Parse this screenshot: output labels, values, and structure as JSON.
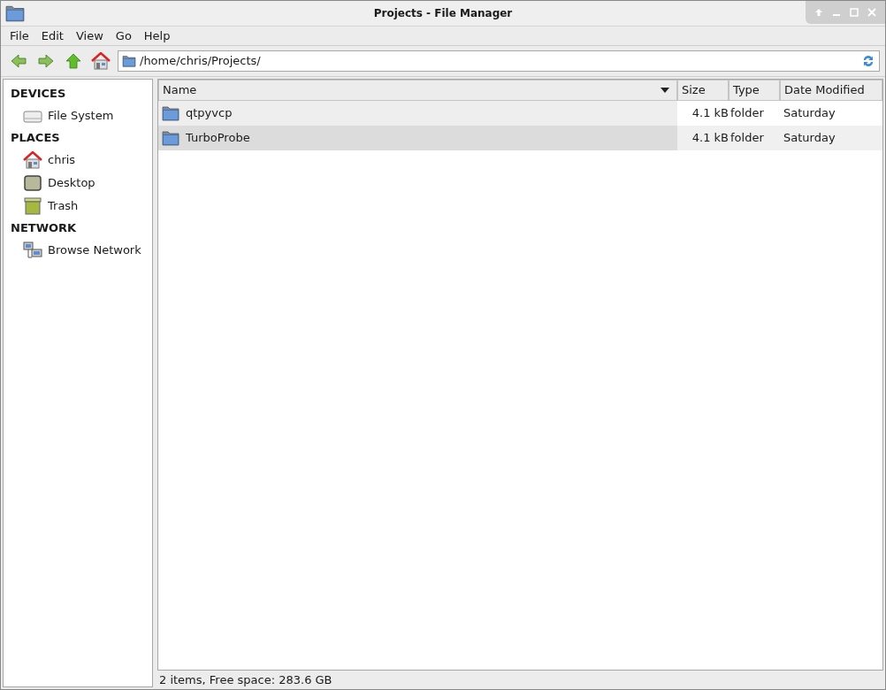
{
  "window": {
    "title": "Projects - File Manager"
  },
  "menu": [
    "File",
    "Edit",
    "View",
    "Go",
    "Help"
  ],
  "toolbar": {
    "path": "/home/chris/Projects/"
  },
  "sidebar": [
    {
      "heading": "DEVICES",
      "items": [
        {
          "label": "File System",
          "kind": "drive"
        }
      ]
    },
    {
      "heading": "PLACES",
      "items": [
        {
          "label": "chris",
          "kind": "home"
        },
        {
          "label": "Desktop",
          "kind": "desktop"
        },
        {
          "label": "Trash",
          "kind": "trash"
        }
      ]
    },
    {
      "heading": "NETWORK",
      "items": [
        {
          "label": "Browse Network",
          "kind": "network"
        }
      ]
    }
  ],
  "table": {
    "columns": [
      "Name",
      "Size",
      "Type",
      "Date Modified"
    ],
    "rows": [
      {
        "name": "qtpyvcp",
        "size": "4.1 kB",
        "type": "folder",
        "modified": "Saturday",
        "selected": false
      },
      {
        "name": "TurboProbe",
        "size": "4.1 kB",
        "type": "folder",
        "modified": "Saturday",
        "selected": true
      }
    ]
  },
  "status_bar": "2 items, Free space: 283.6 GB"
}
